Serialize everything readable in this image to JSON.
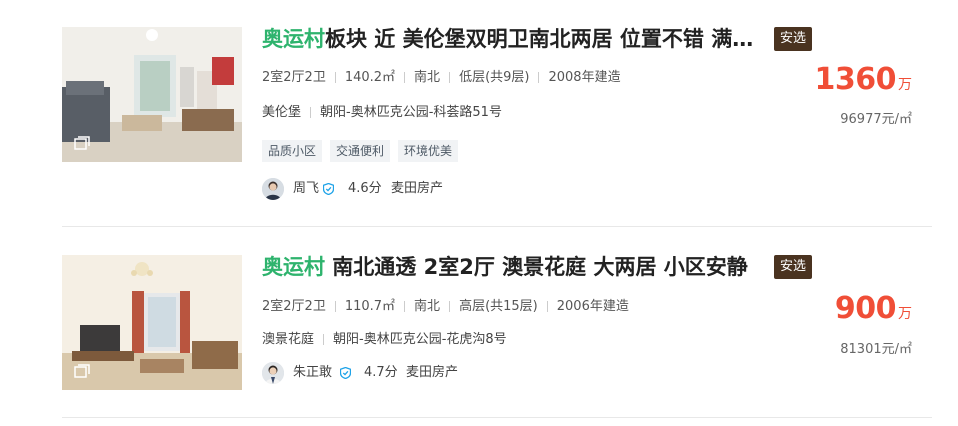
{
  "listings": [
    {
      "title_keyword": "奥运村",
      "title_rest": "板块 近 美伦堡双明卫南北两居 位置不错 满五唯一",
      "badge": "安选",
      "attrs": [
        "2室2厅2卫",
        "140.2㎡",
        "南北",
        "低层(共9层)",
        "2008年建造"
      ],
      "community": "美伦堡",
      "location": "朝阳-奥林匹克公园-科荟路51号",
      "tags": [
        "品质小区",
        "交通便利",
        "环境优美"
      ],
      "agent": {
        "name": "周飞",
        "score": "4.6分",
        "company": "麦田房产"
      },
      "price": {
        "value": "1360",
        "unit": "万",
        "unit_price": "96977元/㎡"
      }
    },
    {
      "title_keyword": "奥运村",
      "title_rest": " 南北通透 2室2厅 澳景花庭 大两居 小区安静",
      "badge": "安选",
      "attrs": [
        "2室2厅2卫",
        "110.7㎡",
        "南北",
        "高层(共15层)",
        "2006年建造"
      ],
      "community": "澳景花庭",
      "location": "朝阳-奥林匹克公园-花虎沟8号",
      "tags": [],
      "agent": {
        "name": "朱正敢",
        "score": "4.7分",
        "company": "麦田房产"
      },
      "price": {
        "value": "900",
        "unit": "万",
        "unit_price": "81301元/㎡"
      }
    }
  ],
  "colors": {
    "keyword": "#2eb36d",
    "price": "#f04e37",
    "badge_bg": "#4a3320",
    "verify": "#1fa3e8"
  }
}
